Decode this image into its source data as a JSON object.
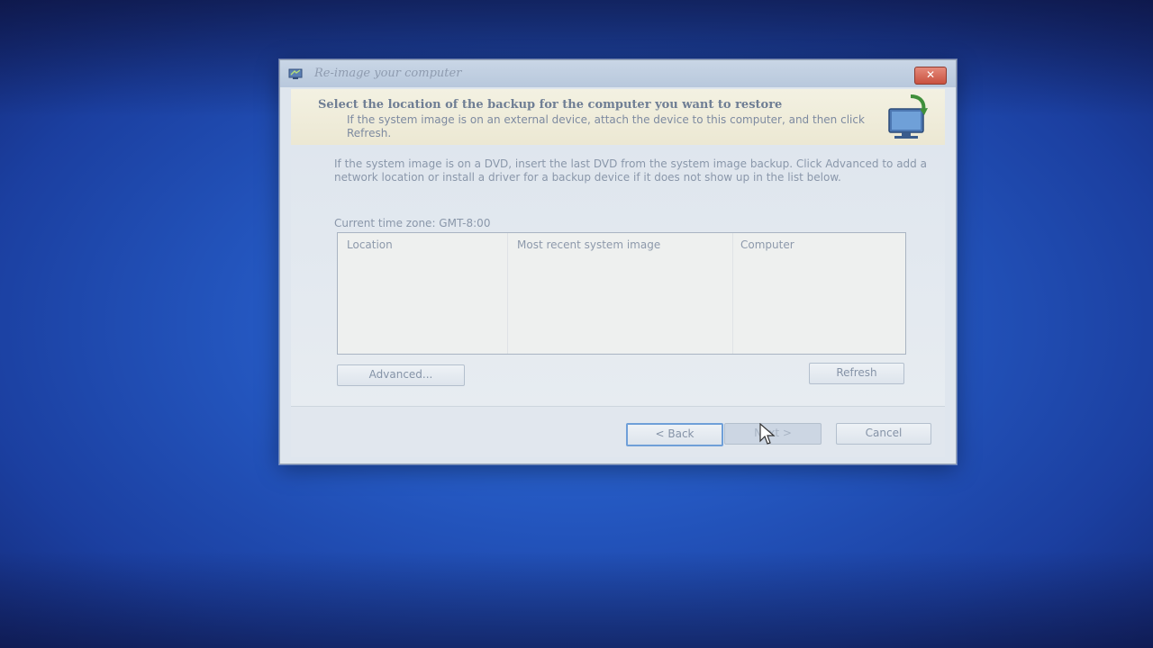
{
  "window": {
    "title": "Re-image your computer",
    "close_label": "✕"
  },
  "header": {
    "title": "Select the location of the backup for the computer you want to restore",
    "description": "If the system image is on an external device, attach the device to this computer, and then click Refresh.",
    "icon": "computer-restore-icon"
  },
  "body": {
    "instructions": "If the system image is on a DVD, insert the last DVD from the system image backup. Click Advanced to add a network location or install a driver for a backup device if it does not show up in the list below.",
    "timezone": "Current time zone: GMT-8:00"
  },
  "table": {
    "columns": [
      "Location",
      "Most recent system image",
      "Computer"
    ],
    "rows": []
  },
  "buttons": {
    "advanced": "Advanced...",
    "refresh": "Refresh",
    "back": "< Back",
    "next": "Next >",
    "cancel": "Cancel"
  },
  "colors": {
    "desktop": "#2457c0",
    "close_button": "#c9513f",
    "focus_border": "#6f9fd8"
  }
}
